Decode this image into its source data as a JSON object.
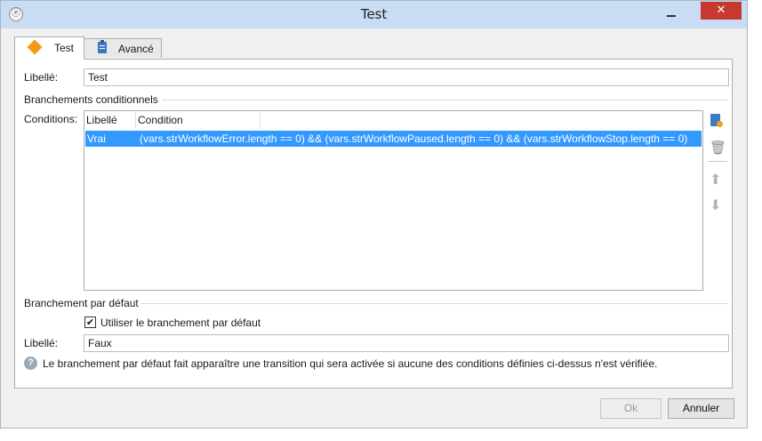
{
  "window": {
    "title": "Test",
    "close_label": "✕",
    "app_icon_glyph": "ⓔ"
  },
  "tabs": [
    {
      "label": "Test",
      "icon": "diamond-icon",
      "active": true
    },
    {
      "label": "Avancé",
      "icon": "clipboard-icon",
      "active": false
    }
  ],
  "form": {
    "libelle_label": "Libellé:",
    "libelle_value": "Test",
    "section_conditional": "Branchements conditionnels",
    "conditions_label": "Conditions:",
    "grid": {
      "columns": [
        "Libellé",
        "Condition"
      ],
      "rows": [
        {
          "libelle": "Vrai",
          "condition": "(vars.strWorkflowError.length == 0) && (vars.strWorkflowPaused.length == 0) && (vars.strWorkflowStop.length == 0)",
          "selected": true
        }
      ]
    },
    "section_default": "Branchement par défaut",
    "use_default_label": "Utiliser le branchement par défaut",
    "use_default_checked": true,
    "checkbox_glyph": "✔",
    "default_libelle_label": "Libellé:",
    "default_libelle_value": "Faux",
    "help_glyph": "?",
    "help_text": "Le branchement par défaut fait apparaître une transition qui sera activée si aucune des conditions définies ci-dessus n'est vérifiée."
  },
  "side_toolbar": {
    "icons": [
      "add-icon",
      "trash-icon",
      "arrow-up-icon",
      "arrow-down-icon"
    ],
    "trash_glyph": "🗑",
    "up_glyph": "⬆",
    "down_glyph": "⬇"
  },
  "buttons": {
    "ok": "Ok",
    "cancel": "Annuler"
  },
  "colors": {
    "selection": "#3399ff",
    "close_button": "#c7392e",
    "titlebar": "#c8dcf4"
  }
}
